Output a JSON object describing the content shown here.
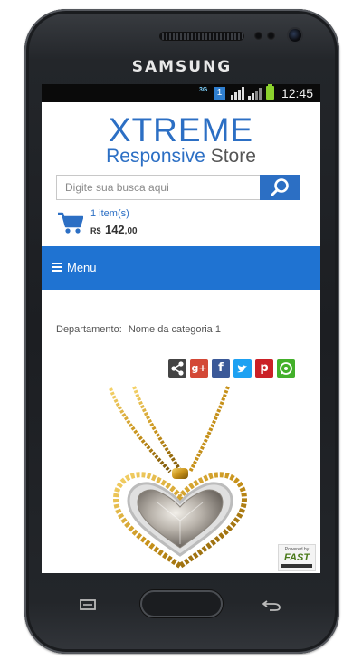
{
  "device": {
    "brand": "SAMSUNG"
  },
  "status_bar": {
    "network": "3G",
    "badge": "1",
    "time": "12:45"
  },
  "header": {
    "logo_top": "XTREME",
    "logo_responsive": "Responsive",
    "logo_store": "Store"
  },
  "search": {
    "placeholder": "Digite sua busca aqui",
    "value": ""
  },
  "cart": {
    "items": "1 item(s)",
    "currency": "R$",
    "amount": "142",
    "cents": ",00"
  },
  "menu": {
    "label": "Menu"
  },
  "breadcrumb": {
    "label": "Departamento:",
    "category": "Nome da categoria 1"
  },
  "share_icons": [
    {
      "name": "share-icon",
      "color": "#444444",
      "glyph": "<"
    },
    {
      "name": "google-plus-icon",
      "color": "#d34836",
      "glyph": "g+"
    },
    {
      "name": "facebook-icon",
      "color": "#3b5998",
      "glyph": "f"
    },
    {
      "name": "twitter-icon",
      "color": "#1da1f2",
      "glyph": "t"
    },
    {
      "name": "pinterest-icon",
      "color": "#cb2027",
      "glyph": "p"
    },
    {
      "name": "whatsapp-icon",
      "color": "#43b02a",
      "glyph": "w"
    }
  ],
  "powered_badge": {
    "line1": "Powered by",
    "line2": "FAST"
  },
  "colors": {
    "primary": "#1f73d2",
    "logo": "#2c6fc4"
  }
}
